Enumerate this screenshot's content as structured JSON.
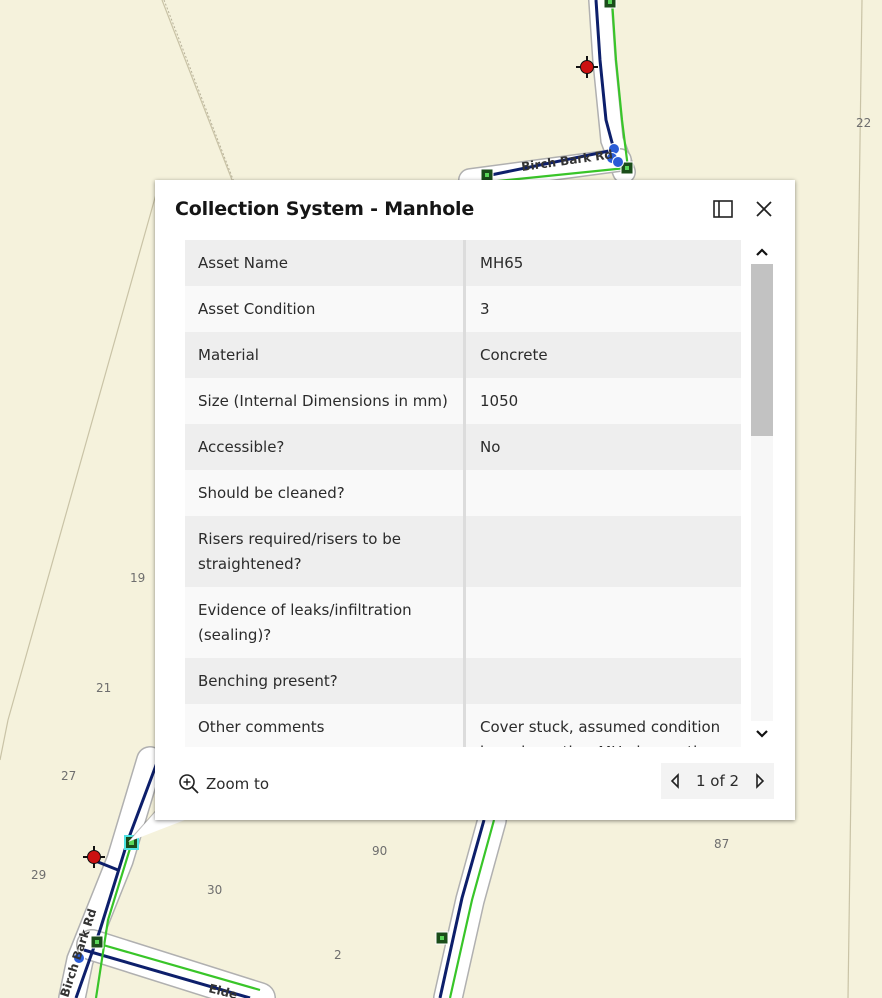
{
  "map": {
    "parcel_labels": [
      "22",
      "19",
      "21",
      "27",
      "29",
      "30",
      "90",
      "87",
      "2"
    ],
    "road_labels": [
      "Birch Bark Rd",
      "Birch Bark Rd",
      "Elde"
    ]
  },
  "popup": {
    "title": "Collection System - Manhole",
    "dock_icon": "dock-icon",
    "close_icon": "close-icon",
    "rows": [
      {
        "field": "Asset Name",
        "value": "MH65"
      },
      {
        "field": "Asset Condition",
        "value": "3"
      },
      {
        "field": "Material",
        "value": "Concrete"
      },
      {
        "field": "Size (Internal Dimensions in mm)",
        "value": "1050"
      },
      {
        "field": "Accessible?",
        "value": "No"
      },
      {
        "field": "Should be cleaned?",
        "value": ""
      },
      {
        "field": "Risers required/risers to be straightened?",
        "value": ""
      },
      {
        "field": "Evidence of leaks/infiltration (sealing)?",
        "value": ""
      },
      {
        "field": "Benching present?",
        "value": ""
      },
      {
        "field": "Other comments",
        "value": "Cover stuck, assumed condition based on other MH observations in the area (same age)."
      }
    ],
    "zoom_label": "Zoom to",
    "pager_text": "1 of 2"
  },
  "colors": {
    "map_background": "#f5f2dc",
    "sewer_line": "#0d1f6b",
    "water_line": "#39c529",
    "manhole_fill": "#1a4d1a",
    "hydrant": "#cc1111",
    "node": "#2a5cd6"
  }
}
